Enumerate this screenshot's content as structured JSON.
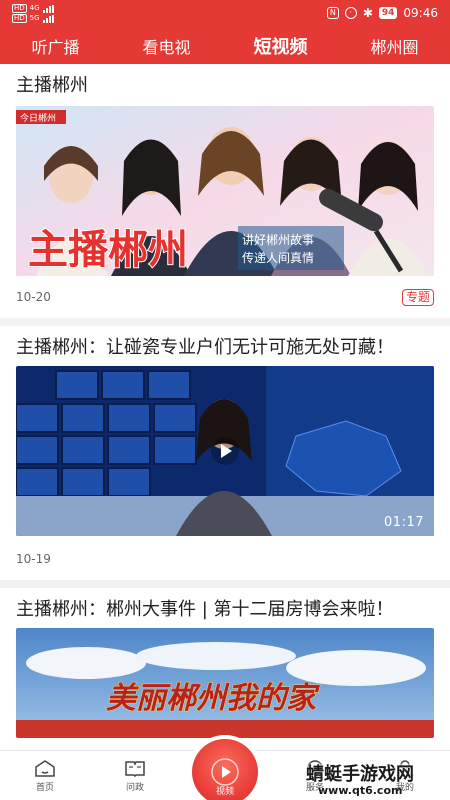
{
  "status_bar": {
    "signal_label": "HD",
    "net_top": "4G",
    "net_bottom": "5G",
    "battery": "94",
    "time": "09:46"
  },
  "tabs": [
    {
      "label": "听广播",
      "active": false
    },
    {
      "label": "看电视",
      "active": false
    },
    {
      "label": "短视频",
      "active": true
    },
    {
      "label": "郴州圈",
      "active": false
    }
  ],
  "feed": {
    "section_title": "主播郴州",
    "items": [
      {
        "banner_main_text": "主播郴州",
        "banner_sub_line1": "讲好郴州故事",
        "banner_sub_line2": "传递人间真情",
        "banner_corner_text": "今日郴州",
        "date": "10-20",
        "tag": "专题"
      },
      {
        "title": "主播郴州：让碰瓷专业户们无计可施无处可藏！",
        "date": "10-19",
        "duration": "01:17"
      },
      {
        "title": "主播郴州：郴州大事件 | 第十二届房博会来啦！",
        "banner_text": "美丽郴州我的家"
      }
    ]
  },
  "bottom_nav": {
    "home": "首页",
    "politics": "问政",
    "video": "视频",
    "services": "服务",
    "mine": "我的"
  },
  "watermark": {
    "name": "蜻蜓手游戏网",
    "url": "www.qt6.com"
  },
  "colors": {
    "brand_red": "#e53935",
    "tag_red": "#e53935"
  }
}
